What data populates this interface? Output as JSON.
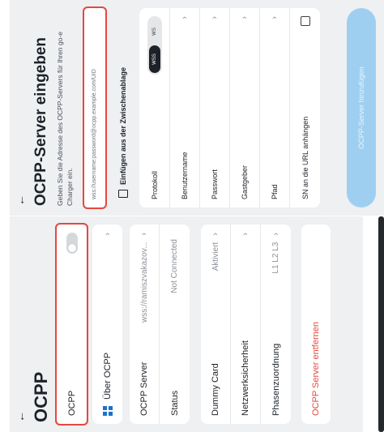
{
  "left": {
    "back_icon": "←",
    "title": "OCPP",
    "toggle": {
      "label": "OCPP",
      "enabled": false
    },
    "about": {
      "label": "Über OCPP"
    },
    "server_rows": [
      {
        "label": "OCPP Server",
        "value": "wss://ramiszvakazov..."
      },
      {
        "label": "Status",
        "value": "Not Connected"
      }
    ],
    "settings_rows": [
      {
        "label": "Dummy Card",
        "value": "Aktiviert"
      },
      {
        "label": "Netzwerksicherheit",
        "value": ""
      },
      {
        "label": "Phasenzuordnung",
        "value": "L1 L2 L3"
      }
    ],
    "remove_label": "OCPP Server entfernen"
  },
  "right": {
    "back_icon": "←",
    "title": "OCPP-Server eingeben",
    "subtitle": "Geben Sie die Adresse des OCPP-Servers für Ihren go-e Charger ein.",
    "url_placeholder": "wss://username:password@ocpp.example.com/UID",
    "paste_label": "Einfügen aus der Zwischenablage",
    "protocol": {
      "label": "Protokoll",
      "options": [
        "WSS",
        "WS"
      ],
      "selected": "WSS"
    },
    "fields": [
      {
        "label": "Benutzername"
      },
      {
        "label": "Passwort"
      },
      {
        "label": "Gastgeber"
      },
      {
        "label": "Pfad"
      }
    ],
    "sn_label": "SN an die URL anhängen",
    "save_label": "OCPP-Server hinzufügen"
  },
  "colors": {
    "accent_red": "#e5483f",
    "brand_blue": "#1a73c9",
    "save_button": "#9fcff0",
    "background": "#eef0f2"
  }
}
